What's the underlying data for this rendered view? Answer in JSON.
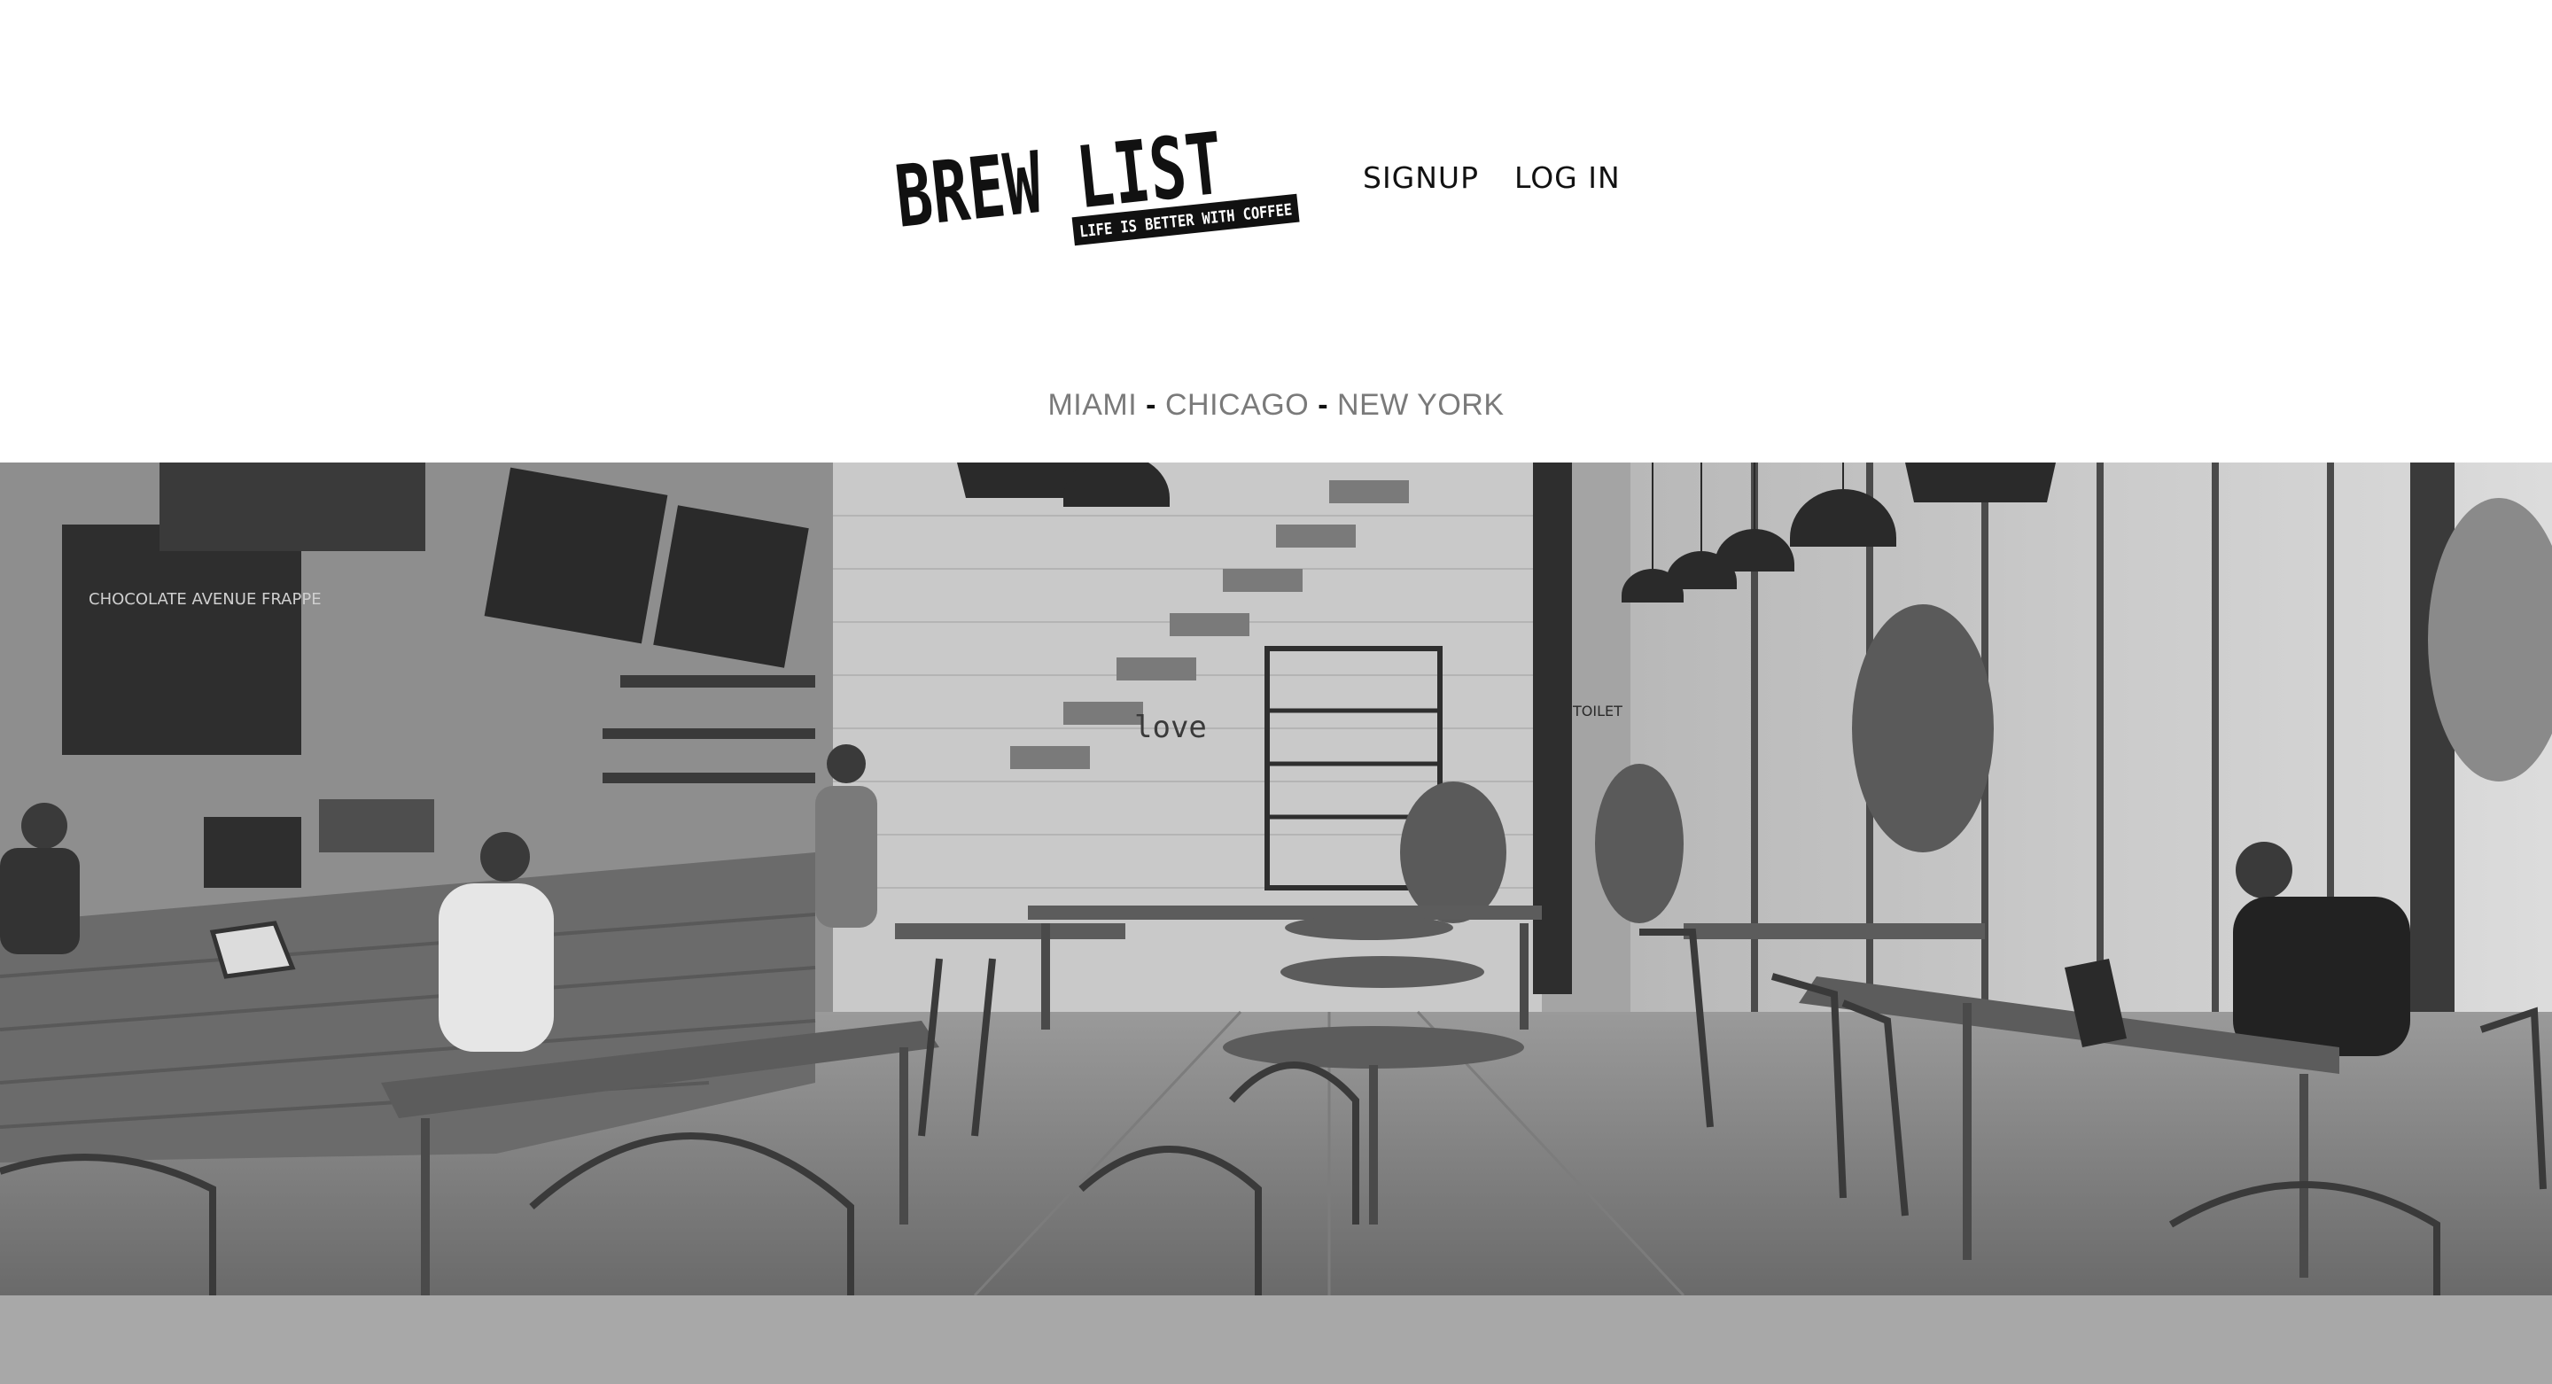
{
  "brand": {
    "name": "BREW LIST",
    "tagline": "LIFE IS BETTER WITH COFFEE"
  },
  "nav": {
    "signup_label": "SIGNUP",
    "login_label": "LOG IN"
  },
  "cities": {
    "items": [
      "MIAMI",
      "CHICAGO",
      "NEW YORK"
    ],
    "separator": "-"
  },
  "hero": {
    "image_alt": "Cafe interior",
    "chalkboard_text": "CHOCOLATE AVENUE FRAPPE",
    "wall_text": "love",
    "sign_text": "TOILET"
  },
  "colors": {
    "background": "#ffffff",
    "nav_text": "#111111",
    "city_text": "#7a7a7a",
    "footer_band": "#a8a8a8"
  }
}
